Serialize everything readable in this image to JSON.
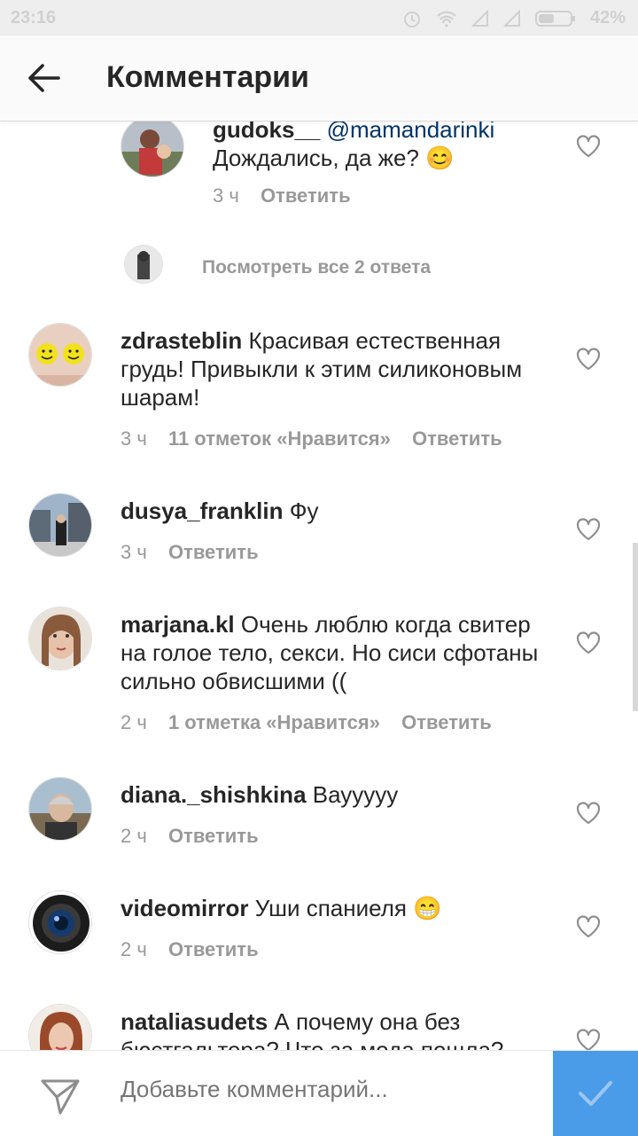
{
  "status_bar": {
    "time": "23:16",
    "battery": "42%"
  },
  "header": {
    "title": "Комментарии"
  },
  "comments": [
    {
      "username": "gudoks__",
      "mention": "@mamandarinki",
      "text": "Дождались, да же? 😊",
      "time": "3 ч",
      "likes": "",
      "reply": "Ответить"
    },
    {
      "username": "zdrasteblin",
      "text": "Красивая естественная грудь! Привыкли к этим силиконовым шарам!",
      "time": "3 ч",
      "likes": "11 отметок «Нравится»",
      "reply": "Ответить"
    },
    {
      "username": "dusya_franklin",
      "text": "Фу",
      "time": "3 ч",
      "likes": "",
      "reply": "Ответить"
    },
    {
      "username": "marjana.kl",
      "text": "Очень люблю когда свитер на голое тело, секси. Но сиси сфотаны сильно обвисшими ((",
      "time": "2 ч",
      "likes": "1 отметка «Нравится»",
      "reply": "Ответить"
    },
    {
      "username": "diana._shishkina",
      "text": "Вауууyy",
      "time": "2 ч",
      "likes": "",
      "reply": "Ответить"
    },
    {
      "username": "videomirror",
      "text": "Уши спаниеля 😁",
      "time": "2 ч",
      "likes": "",
      "reply": "Ответить"
    },
    {
      "username": "nataliasudets",
      "text": "А почему она без бюстгальтера? Что за мода пошла?",
      "time": "",
      "likes": "",
      "reply": ""
    }
  ],
  "view_replies": "Посмотреть все 2 ответа",
  "composer": {
    "placeholder": "Добавьте комментарий..."
  },
  "colors": {
    "accent": "#4a9ce8",
    "mention": "#003569",
    "meta": "#999999"
  }
}
